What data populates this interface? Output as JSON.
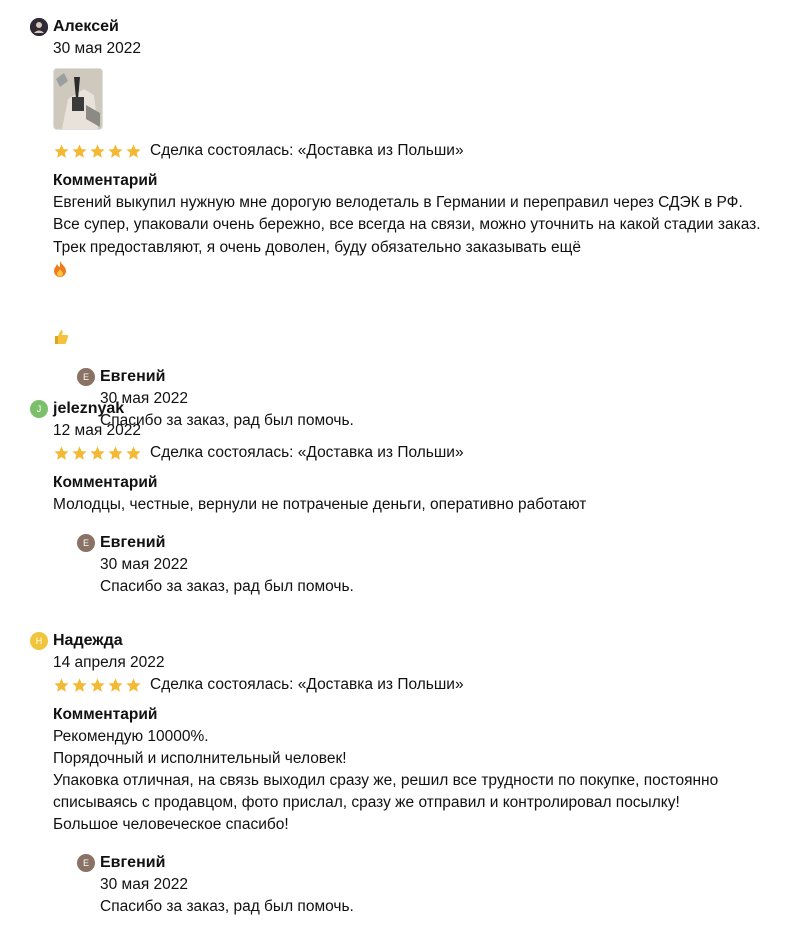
{
  "reviews": [
    {
      "author": "Алексей",
      "avatar_color": "#3a3440",
      "date": "30 мая 2022",
      "has_photo": true,
      "deal": "Сделка состоялась: «Доставка из Польши»",
      "comment_title": "Комментарий",
      "comment": "Евгений выкупил нужную мне дорогую велодеталь в Германии и переправил через СДЭК в РФ. Все супер, упаковали очень бережно, все всегда на связи, можно уточнить на какой стадии заказ. Трек предоставляют, я очень доволен, буду обязательно заказывать ещё",
      "emoji": [
        "fire-icon",
        "thumbs-up-icon"
      ],
      "reply": {
        "initial": "Е",
        "author": "Евгений",
        "avatar_color": "#8a7264",
        "date": "30 мая 2022",
        "text": "Спасибо за заказ, рад был помочь."
      }
    },
    {
      "author": "jeleznyak",
      "initial": "J",
      "avatar_color": "#7cbf6a",
      "date": "12 мая 2022",
      "deal": "Сделка состоялась: «Доставка из Польши»",
      "comment_title": "Комментарий",
      "comment": "Молодцы, честные, вернули не потраченые деньги, оперативно работают",
      "reply": {
        "initial": "Е",
        "author": "Евгений",
        "avatar_color": "#8a7264",
        "date": "30 мая 2022",
        "text": "Спасибо за заказ, рад был помочь."
      }
    },
    {
      "author": "Надежда",
      "initial": "Н",
      "avatar_color": "#f0c53c",
      "date": "14 апреля 2022",
      "deal": "Сделка состоялась: «Доставка из Польши»",
      "comment_title": "Комментарий",
      "comment": "Рекомендую 10000%.\nПорядочный и исполнительный человек!\nУпаковка отличная, на связь выходил сразу же, решил все трудности по покупке, постоянно списываясь с продавцом, фото прислал, сразу же отправил и контролировал посылку!\nБольшое человеческое спасибо!",
      "reply": {
        "initial": "Е",
        "author": "Евгений",
        "avatar_color": "#8a7264",
        "date": "30 мая 2022",
        "text": "Спасибо за заказ, рад был помочь."
      }
    }
  ],
  "rating_stars": 5,
  "star_color": "#f3b935"
}
